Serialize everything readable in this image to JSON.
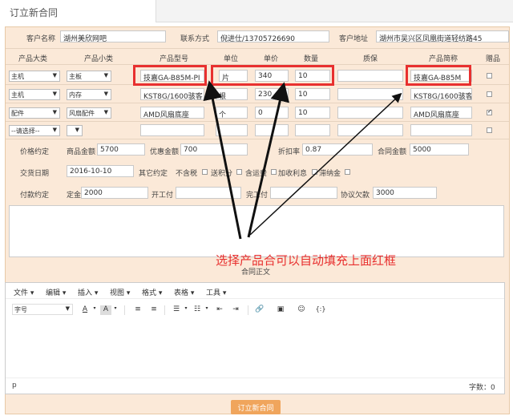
{
  "tab": {
    "title": "订立新合同"
  },
  "customer": {
    "name_label": "客户名称",
    "name_value": "湖州美欣网吧",
    "contact_label": "联系方式",
    "contact_value": "倪进仕/13705726690",
    "address_label": "客户地址",
    "address_value": "湖州市吴兴区凤凰街道轻纺路45"
  },
  "products": {
    "headers": [
      "产品大类",
      "产品小类",
      "产品型号",
      "单位",
      "单价",
      "数量",
      "质保",
      "产品简称",
      "赠品"
    ],
    "rows": [
      {
        "category": "主机",
        "subcategory": "主板",
        "model": "技嘉GA-B85M-PI",
        "unit": "片",
        "price": "340",
        "qty": "10",
        "warranty": "",
        "short": "技嘉GA-B85M",
        "gift": false
      },
      {
        "category": "主机",
        "subcategory": "内存",
        "model": "KST8G/1600骇客",
        "unit": "根",
        "price": "230",
        "qty": "10",
        "warranty": "",
        "short": "KST8G/1600骇客",
        "gift": false
      },
      {
        "category": "配件",
        "subcategory": "风扇配件",
        "model": "AMD风扇底座",
        "unit": "个",
        "price": "0",
        "qty": "10",
        "warranty": "",
        "short": "AMD风扇底座",
        "gift": true
      },
      {
        "category": "--请选择--",
        "subcategory": "",
        "model": "",
        "unit": "",
        "price": "",
        "qty": "",
        "warranty": "",
        "short": "",
        "gift": false
      }
    ]
  },
  "price": {
    "section_label": "价格约定",
    "goods_label": "商品金额",
    "goods_value": "5700",
    "discount_label": "优惠金额",
    "discount_value": "700",
    "rate_label": "折扣率",
    "rate_value": "0.87",
    "total_label": "合同金额",
    "total_value": "5000"
  },
  "delivery": {
    "section_label": "交货日期",
    "date_value": "2016-10-10",
    "other_label": "其它约定",
    "options": [
      "不含税",
      "送积分",
      "含运费",
      "加收利息",
      "滞纳金"
    ]
  },
  "payment": {
    "section_label": "付款约定",
    "deposit_label": "定金",
    "deposit_value": "2000",
    "start_label": "开工付",
    "start_value": "",
    "finish_label": "完工付",
    "finish_value": "",
    "owed_label": "协议欠款",
    "owed_value": "3000"
  },
  "annotation": {
    "text": "选择产品合可以自动填充上面红框"
  },
  "editor": {
    "title": "合同正文",
    "menus": [
      "文件",
      "编辑",
      "插入",
      "视图",
      "格式",
      "表格",
      "工具"
    ],
    "fontsize_label": "字号",
    "status_path": "p",
    "wordcount": "字数：0"
  },
  "submit_label": "订立新合同",
  "colors": {
    "accent": "#f0a55c",
    "highlight": "#e8302f",
    "form_bg": "#fbe9d8"
  }
}
